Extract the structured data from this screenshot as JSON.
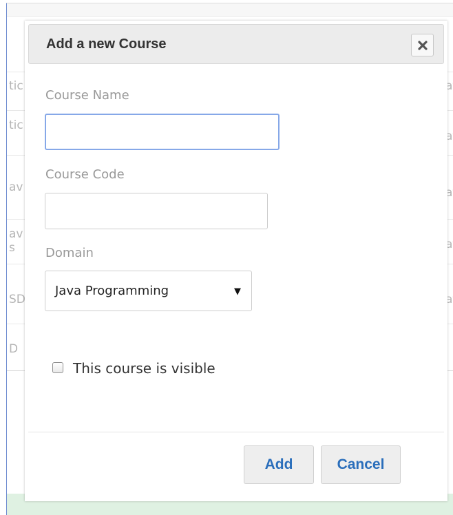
{
  "background": {
    "rows_left": [
      "tic",
      "tic",
      "av",
      "av",
      "s",
      "SD",
      "D"
    ],
    "rows_right": [
      "at",
      "at",
      "at",
      "at",
      "at"
    ]
  },
  "dialog": {
    "title": "Add a new Course",
    "close_icon": "close-icon",
    "fields": {
      "course_name": {
        "label": "Course Name",
        "value": "",
        "placeholder": ""
      },
      "course_code": {
        "label": "Course Code",
        "value": "",
        "placeholder": ""
      },
      "domain": {
        "label": "Domain",
        "selected": "Java Programming"
      }
    },
    "visible_checkbox": {
      "label": "This course is visible",
      "checked": false
    },
    "buttons": {
      "add": "Add",
      "cancel": "Cancel"
    }
  },
  "colors": {
    "accent": "#2a6ebb",
    "focus_border": "#86a8e8",
    "header_bg": "#ececec",
    "background_green": "#dff1e2"
  }
}
